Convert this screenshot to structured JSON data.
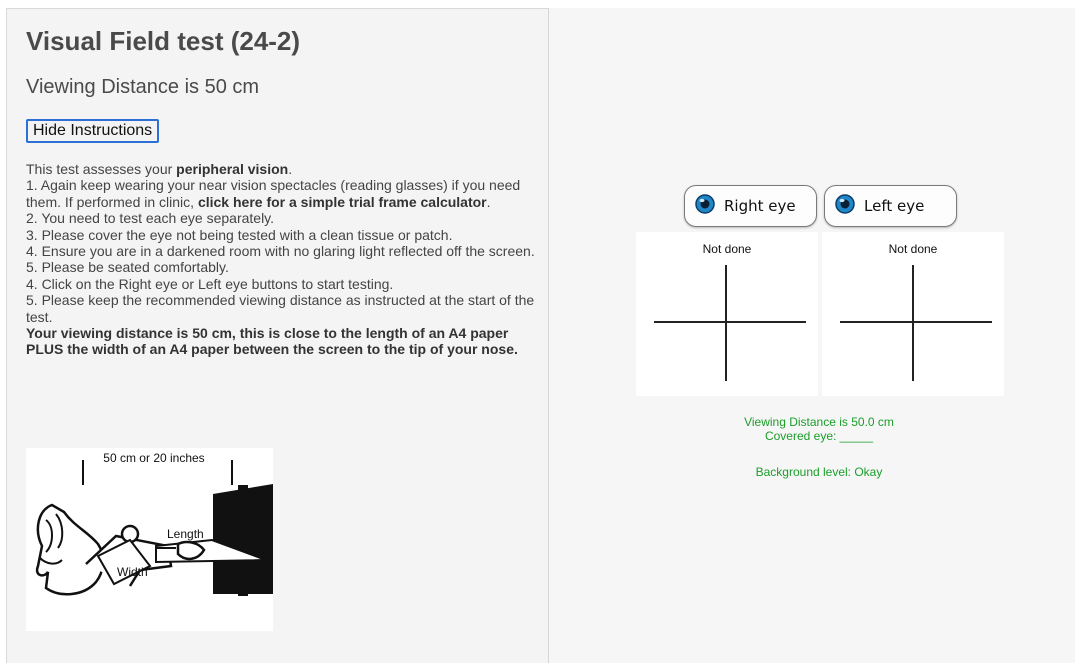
{
  "title": "Visual Field test (24-2)",
  "subtitle": "Viewing Distance is 50 cm",
  "hide_button": "Hide Instructions",
  "instructions": {
    "intro_pre": "This test assesses your ",
    "intro_bold": "peripheral vision",
    "intro_post": ".",
    "step1_pre": "1. Again keep wearing your near vision spectacles (reading glasses) if you need them. If performed in clinic, ",
    "step1_link": "click here for a simple trial frame calculator",
    "step1_post": ".",
    "step2": "2. You need to test each eye separately.",
    "step3": "3. Please cover the eye not being tested with a clean tissue or patch.",
    "step4": "4. Ensure you are in a darkened room with no glaring light reflected off the screen.",
    "step5": "5. Please be seated comfortably.",
    "step6": "4. Click on the Right eye or Left eye buttons to start testing.",
    "step7": "5. Please keep the recommended viewing distance as instructed at the start of the test.",
    "distance_note": "Your viewing distance is 50 cm, this is close to the length of an A4 paper PLUS the width of an A4 paper between the screen to the tip of your nose."
  },
  "diagram": {
    "distance_label": "50 cm or 20 inches",
    "length_label": "Length",
    "width_label": "Width"
  },
  "eye_buttons": {
    "right": "Right eye",
    "left": "Left eye"
  },
  "fields": {
    "right_status": "Not done",
    "left_status": "Not done"
  },
  "readout": {
    "distance": "Viewing Distance is 50.0 cm",
    "covered": "Covered eye: _____",
    "background": "Background level: Okay"
  },
  "colors": {
    "readout_green": "#1b9e2a",
    "button_focus_blue": "#2c6fd6",
    "eye_icon_blue": "#1f86c8"
  },
  "icons": {
    "eye_button_icon": "eye-icon"
  }
}
